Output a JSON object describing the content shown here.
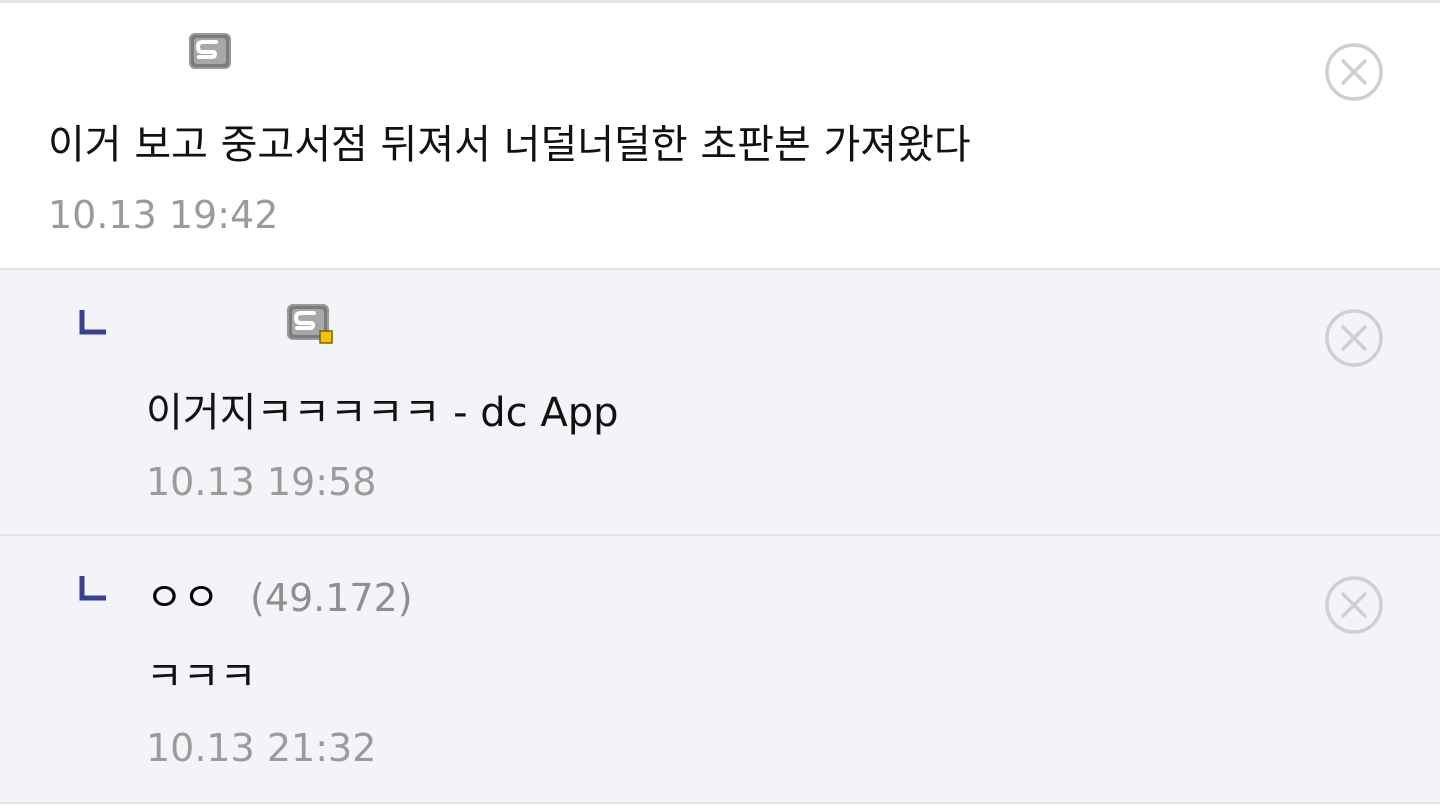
{
  "comments": [
    {
      "nickname": "",
      "text": "이거 보고 중고서점 뒤져서 너덜너덜한 초판본 가져왔다",
      "date": "10.13 19:42",
      "icon": "gallery-nick-icon"
    },
    {
      "nickname": "",
      "text": "이거지ㅋㅋㅋㅋㅋ - dc App",
      "date": "10.13 19:58",
      "icon": "gallery-nick-icon-manager",
      "reply": true
    },
    {
      "nickname": "ㅇㅇ",
      "ip": "(49.172)",
      "text": "ㅋㅋㅋ",
      "date": "10.13 21:32",
      "reply": true
    }
  ],
  "icons": {
    "delete": "close-circle-icon",
    "reply": "reply-arrow-icon"
  },
  "colors": {
    "reply_mark": "#3b3f8f",
    "reply_bg": "#f3f4f8",
    "date": "#9b9b9b",
    "ip": "#8f8f8f",
    "delete_icon": "#cfcfcf",
    "divider": "#dfe1e8"
  }
}
